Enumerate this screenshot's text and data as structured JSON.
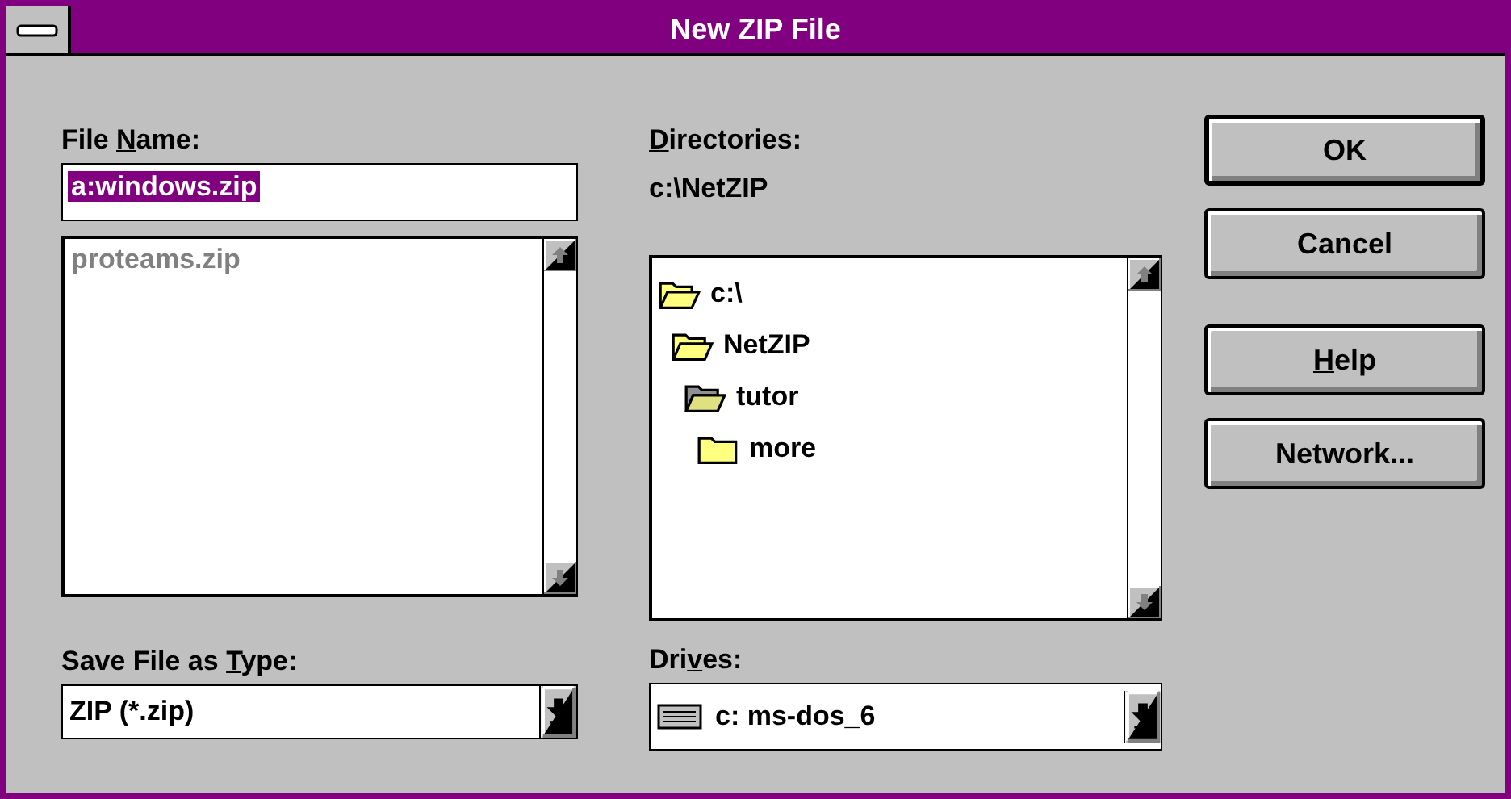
{
  "window": {
    "title": "New ZIP File"
  },
  "file_name": {
    "label": {
      "before": "File ",
      "accel": "N",
      "after": "ame:"
    },
    "value": "a:windows.zip",
    "files": [
      {
        "name": "proteams.zip",
        "disabled": true
      }
    ]
  },
  "directories": {
    "label": {
      "accel": "D",
      "after": "irectories:"
    },
    "path": "c:\\NetZIP",
    "tree": [
      {
        "name": "c:\\",
        "kind": "open",
        "children": [
          {
            "name": "NetZIP",
            "kind": "open",
            "children": [
              {
                "name": "tutor",
                "kind": "current",
                "children": [
                  {
                    "name": "more",
                    "kind": "closed"
                  }
                ]
              }
            ]
          }
        ]
      }
    ]
  },
  "save_type": {
    "label": {
      "before": "Save File as ",
      "accel": "T",
      "after": "ype:"
    },
    "value": "ZIP (*.zip)"
  },
  "drives": {
    "label": {
      "before": "Dri",
      "accel": "v",
      "after": "es:"
    },
    "value": "c: ms-dos_6"
  },
  "buttons": [
    {
      "after": "OK",
      "default": true
    },
    {
      "after": "Cancel",
      "default": false
    },
    {
      "accel": "H",
      "after": "elp",
      "default": false
    },
    {
      "after": "Network...",
      "default": false
    }
  ]
}
